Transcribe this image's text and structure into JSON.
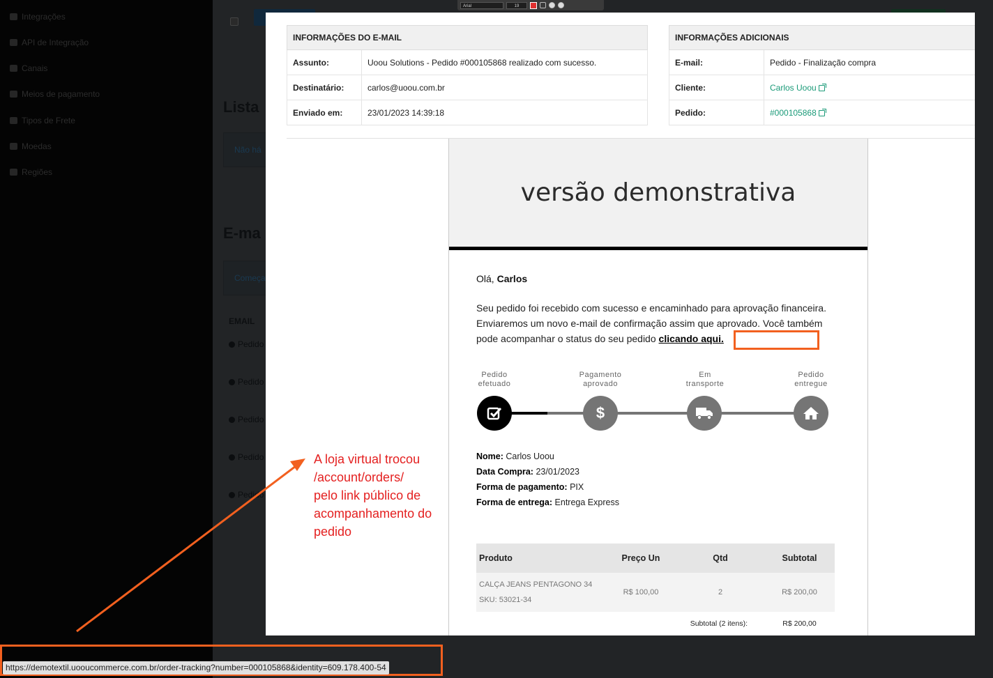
{
  "background": {
    "sidebar_items": [
      "Integrações",
      "API de Integração",
      "Canais",
      "Meios de pagamento",
      "Tipos de Frete",
      "Moedas",
      "Regiões"
    ],
    "headings": [
      "Lista",
      "E-ma"
    ],
    "box_texts": [
      "Não há",
      "Começa"
    ],
    "email_column": "EMAIL",
    "row_label": "Pedido"
  },
  "toolbar": {
    "font": "Arial",
    "size": "19"
  },
  "email_info": {
    "header": "INFORMAÇÕES DO E-MAIL",
    "rows": [
      {
        "label": "Assunto:",
        "value": "Uoou Solutions - Pedido #000105868 realizado com sucesso."
      },
      {
        "label": "Destinatário:",
        "value": "carlos@uoou.com.br"
      },
      {
        "label": "Enviado em:",
        "value": "23/01/2023 14:39:18"
      }
    ]
  },
  "additional_info": {
    "header": "INFORMAÇÕES ADICIONAIS",
    "rows": [
      {
        "label": "E-mail:",
        "value": "Pedido - Finalização compra"
      },
      {
        "label": "Cliente:",
        "value": "Carlos Uoou"
      },
      {
        "label": "Pedido:",
        "value": "#000105868"
      }
    ]
  },
  "email": {
    "banner": "versão demonstrativa",
    "greeting_prefix": "Olá,",
    "greeting_name": "Carlos",
    "paragraph": "Seu pedido foi recebido com sucesso e encaminhado para aprovação financeira. Enviaremos um novo e-mail de confirmação assim que aprovado. Você também pode acompanhar o status do seu pedido",
    "link_text": "clicando aqui.",
    "steps": [
      {
        "label1": "Pedido",
        "label2": "efetuado",
        "icon": "check-icon"
      },
      {
        "label1": "Pagamento",
        "label2": "aprovado",
        "icon": "dollar-icon"
      },
      {
        "label1": "Em",
        "label2": "transporte",
        "icon": "truck-icon"
      },
      {
        "label1": "Pedido",
        "label2": "entregue",
        "icon": "home-icon"
      }
    ],
    "details": [
      {
        "label": "Nome:",
        "value": "Carlos Uoou"
      },
      {
        "label": "Data Compra:",
        "value": "23/01/2023"
      },
      {
        "label": "Forma de pagamento:",
        "value": "PIX"
      },
      {
        "label": "Forma de entrega:",
        "value": "Entrega Express"
      }
    ],
    "product_table": {
      "headers": [
        "Produto",
        "Preço Un",
        "Qtd",
        "Subtotal"
      ],
      "row": {
        "name": "CALÇA JEANS PENTAGONO 34",
        "sku": "SKU: 53021-34",
        "price": "R$ 100,00",
        "qty": "2",
        "subtotal": "R$ 200,00"
      },
      "subtotal_label": "Subtotal (2 itens):",
      "subtotal_value": "R$ 200,00"
    }
  },
  "annotation": {
    "lines": [
      "A loja virtual trocou",
      "/account/orders/",
      "pelo link público de",
      "acompanhamento do",
      "pedido"
    ]
  },
  "status_url": "https://demotextil.uooucommerce.com.br/order-tracking?number=000105868&identity=609.178.400-54",
  "colors": {
    "annotation": "#e42020",
    "highlight": "#f2601f",
    "link": "#1a9a78"
  }
}
